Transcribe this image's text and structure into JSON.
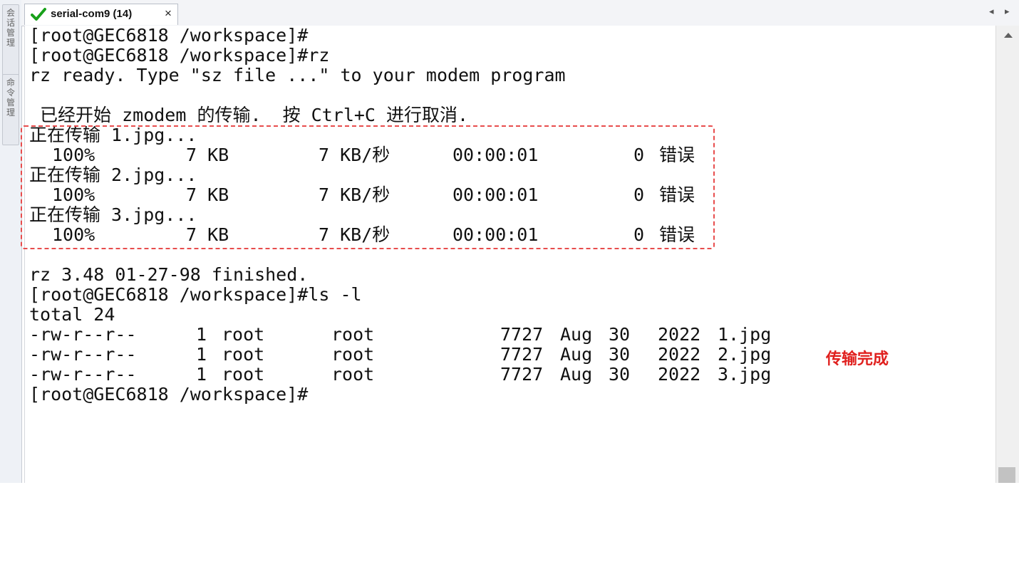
{
  "session_panel": {
    "tab1_chars": [
      "会",
      "话",
      "管",
      "理"
    ],
    "tab2_chars": [
      "命",
      "令",
      "管",
      "理"
    ]
  },
  "tab": {
    "title": "serial-com9 (14)",
    "close": "×",
    "status_icon": "check-icon",
    "status_color": "#18a01a"
  },
  "nav": {
    "left": "◂",
    "right": "▸"
  },
  "terminal": {
    "lines": [
      "[root@GEC6818 /workspace]#",
      "[root@GEC6818 /workspace]#rz",
      "rz ready. Type \"sz file ...\" to your modem program",
      "",
      " 已经开始 zmodem 的传输.  按 Ctrl+C 进行取消.",
      "正在传输 1.jpg...",
      "",
      "正在传输 2.jpg...",
      "",
      "正在传输 3.jpg...",
      "",
      "",
      "rz 3.48 01-27-98 finished.",
      "[root@GEC6818 /workspace]#ls -l",
      "total 24",
      "",
      "",
      "",
      "[root@GEC6818 /workspace]#"
    ],
    "progress_rows": [
      {
        "percent": "100%",
        "size": "7 KB",
        "rate": "7 KB/秒",
        "time": "00:00:01",
        "errors": "0",
        "err_label": "错误"
      },
      {
        "percent": "100%",
        "size": "7 KB",
        "rate": "7 KB/秒",
        "time": "00:00:01",
        "errors": "0",
        "err_label": "错误"
      },
      {
        "percent": "100%",
        "size": "7 KB",
        "rate": "7 KB/秒",
        "time": "00:00:01",
        "errors": "0",
        "err_label": "错误"
      }
    ],
    "files": [
      {
        "perms": "-rw-r--r--",
        "links": "1",
        "owner": "root",
        "group": "root",
        "size": "7727",
        "month": "Aug",
        "day": "30",
        "year": "2022",
        "name": "1.jpg"
      },
      {
        "perms": "-rw-r--r--",
        "links": "1",
        "owner": "root",
        "group": "root",
        "size": "7727",
        "month": "Aug",
        "day": "30",
        "year": "2022",
        "name": "2.jpg"
      },
      {
        "perms": "-rw-r--r--",
        "links": "1",
        "owner": "root",
        "group": "root",
        "size": "7727",
        "month": "Aug",
        "day": "30",
        "year": "2022",
        "name": "3.jpg"
      }
    ],
    "annotation": "传输完成",
    "annotation_color": "#e0201e",
    "highlight_color": "#e84d4d"
  }
}
